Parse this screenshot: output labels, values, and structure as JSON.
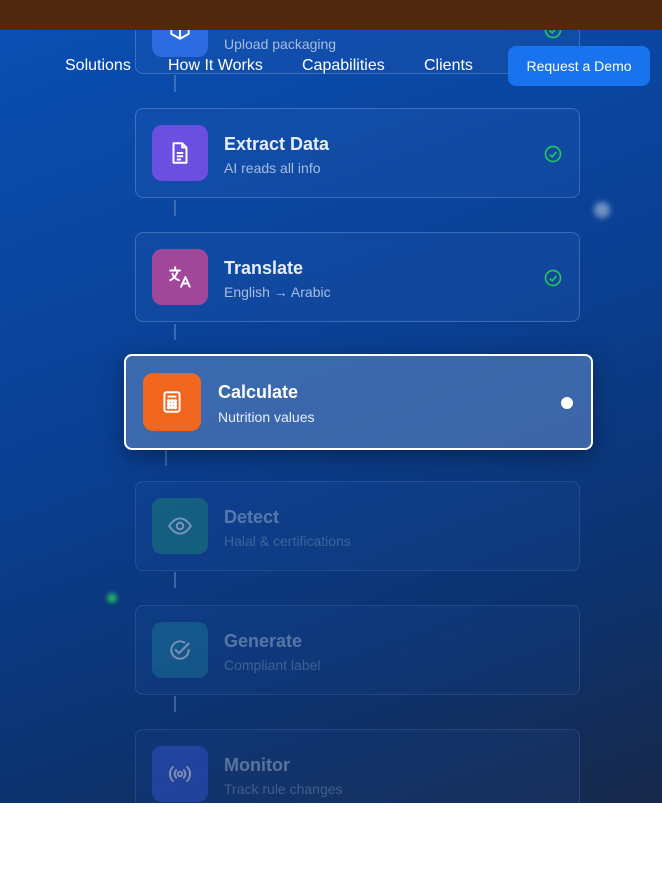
{
  "nav": {
    "links": [
      "Solutions",
      "How It Works",
      "Capabilities",
      "Clients"
    ],
    "cta_label": "Request a Demo"
  },
  "steps": [
    {
      "title": "",
      "subtitle": "Upload packaging",
      "status": "done",
      "icon": "cube-icon",
      "color": "#2d6be0"
    },
    {
      "title": "Extract Data",
      "subtitle": "AI reads all info",
      "status": "done",
      "icon": "document-icon",
      "color": "#6b4fe0"
    },
    {
      "title": "Translate",
      "subtitle": "English → Arabic",
      "status": "done",
      "icon": "translate-icon",
      "color": "#a0479a"
    },
    {
      "title": "Calculate",
      "subtitle": "Nutrition values",
      "status": "active",
      "icon": "calculator-icon",
      "color": "#f2671f"
    },
    {
      "title": "Detect",
      "subtitle": "Halal & certifications",
      "status": "pending",
      "icon": "eye-icon",
      "color": "#1f8a7a"
    },
    {
      "title": "Generate",
      "subtitle": "Compliant label",
      "status": "pending",
      "icon": "check-circle-icon",
      "color": "#1f7fa0"
    },
    {
      "title": "Monitor",
      "subtitle": "Track rule changes",
      "status": "pending",
      "icon": "broadcast-icon",
      "color": "#3a5ae0"
    }
  ],
  "colors": {
    "accent": "#1a73ee",
    "check_green": "#22c55e",
    "top_bar": "#4f2a0e"
  }
}
